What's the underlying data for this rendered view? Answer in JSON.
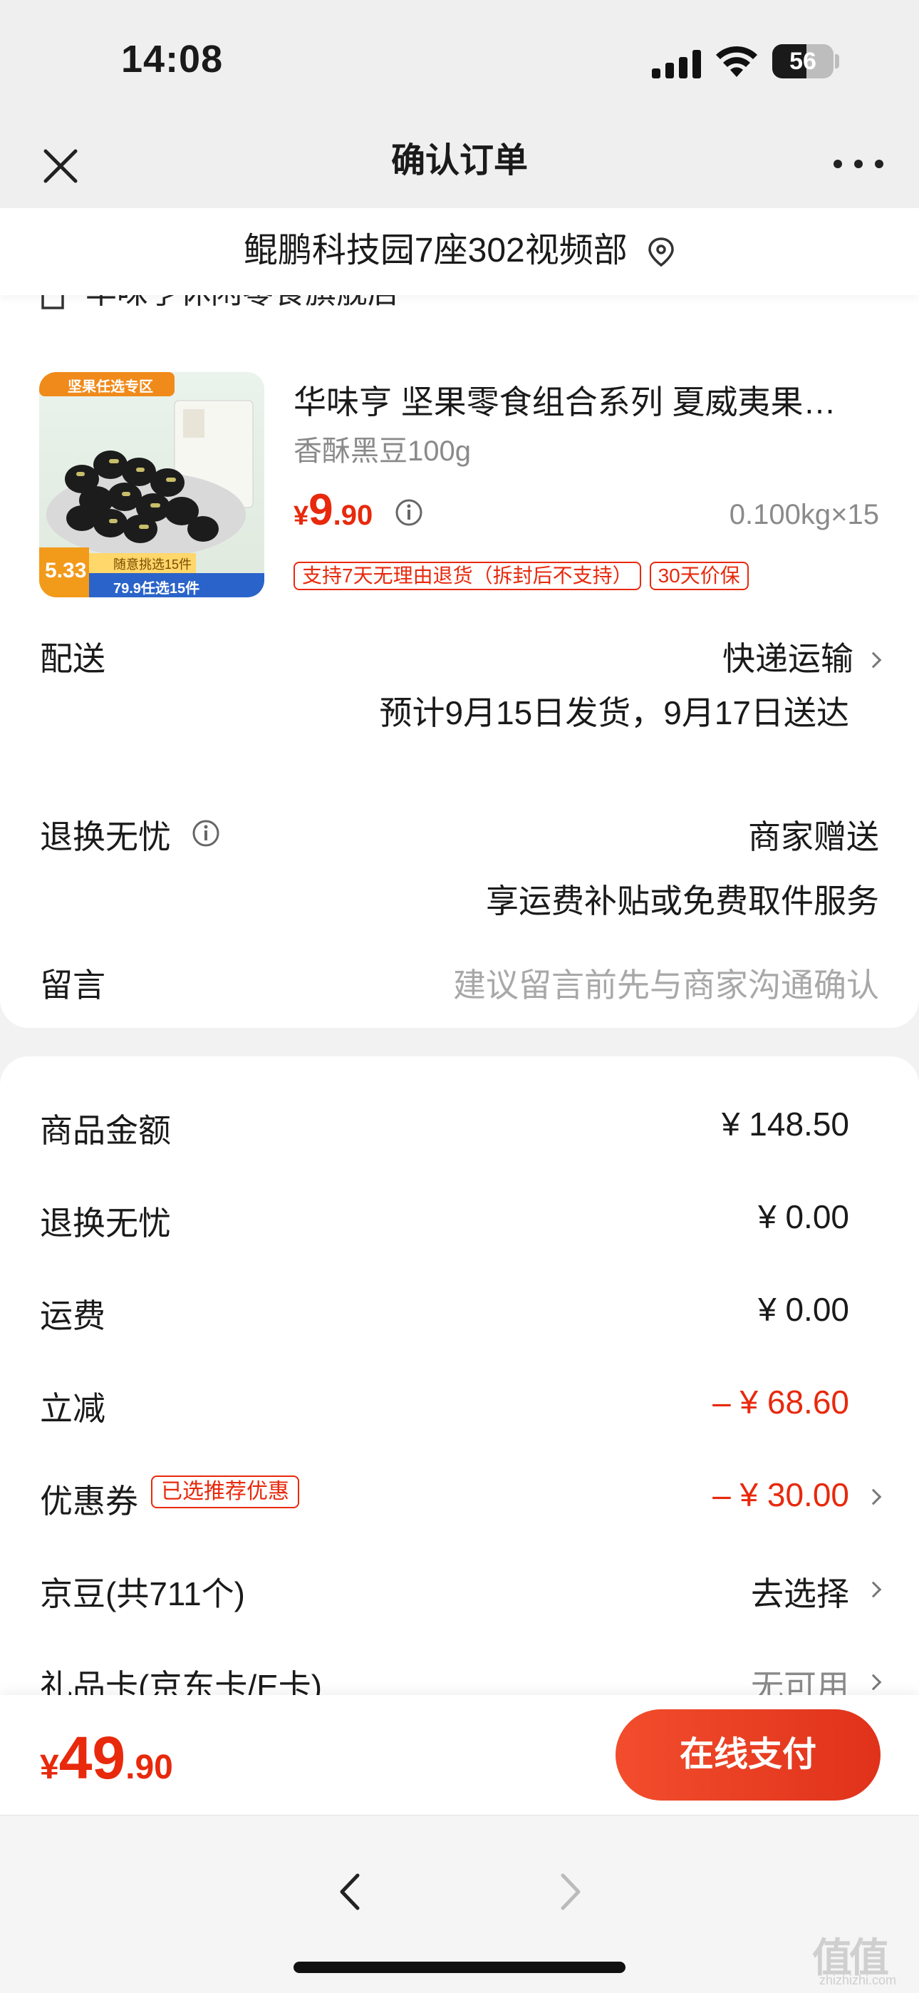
{
  "status_bar": {
    "time": "14:08",
    "battery": "56",
    "battery_level": 0.56
  },
  "nav": {
    "title": "确认订单",
    "close_icon": "close-icon",
    "more_icon": "more-icon"
  },
  "address": {
    "text": "鲲鹏科技园7座302视频部",
    "icon": "location-pin-icon"
  },
  "store": {
    "name": "华味亨休闲零食旗舰店",
    "icon": "store-icon"
  },
  "product": {
    "image_badge_top": "坚果任选专区",
    "image_badge_price": "5.33",
    "image_badge_note": "随意挑选15件",
    "image_badge_bottom": "79.9任选15件",
    "title": "华味亨 坚果零食组合系列 夏威夷果…",
    "spec": "香酥黑豆100g",
    "price_currency": "¥",
    "price_int": "9",
    "price_dec": ".90",
    "quantity": "0.100kg×15",
    "tags": [
      "支持7天无理由退货（拆封后不支持）",
      "30天价保"
    ]
  },
  "delivery": {
    "label": "配送",
    "method": "快递运输",
    "estimate": "预计9月15日发货，9月17日送达"
  },
  "return_service": {
    "label": "退换无忧",
    "value": "商家赠送",
    "desc": "享运费补贴或免费取件服务"
  },
  "message": {
    "label": "留言",
    "placeholder": "建议留言前先与商家沟通确认"
  },
  "summary": {
    "goods_amount": {
      "label": "商品金额",
      "value": "¥ 148.50"
    },
    "return_fee": {
      "label": "退换无忧",
      "value": "¥ 0.00"
    },
    "shipping": {
      "label": "运费",
      "value": "¥ 0.00"
    },
    "discount": {
      "label": "立减",
      "value": "– ¥ 68.60"
    },
    "coupon": {
      "label": "优惠券",
      "tag": "已选推荐优惠",
      "value": "– ¥ 30.00"
    },
    "jingdou": {
      "label": "京豆(共711个)",
      "value": "去选择"
    },
    "gift_card": {
      "label": "礼品卡(京东卡/E卡)",
      "value": "无可用"
    }
  },
  "pay": {
    "currency": "¥",
    "total_int": "49",
    "total_dec": ".90",
    "button": "在线支付"
  },
  "browser": {
    "back_icon": "back-arrow-icon",
    "forward_icon": "forward-arrow-icon"
  },
  "watermark": {
    "text": "值值值",
    "sub": "zhizhizhi.com"
  },
  "colors": {
    "accent": "#e8290c",
    "muted": "#8a8a8a",
    "background": "#f2f2f2"
  }
}
